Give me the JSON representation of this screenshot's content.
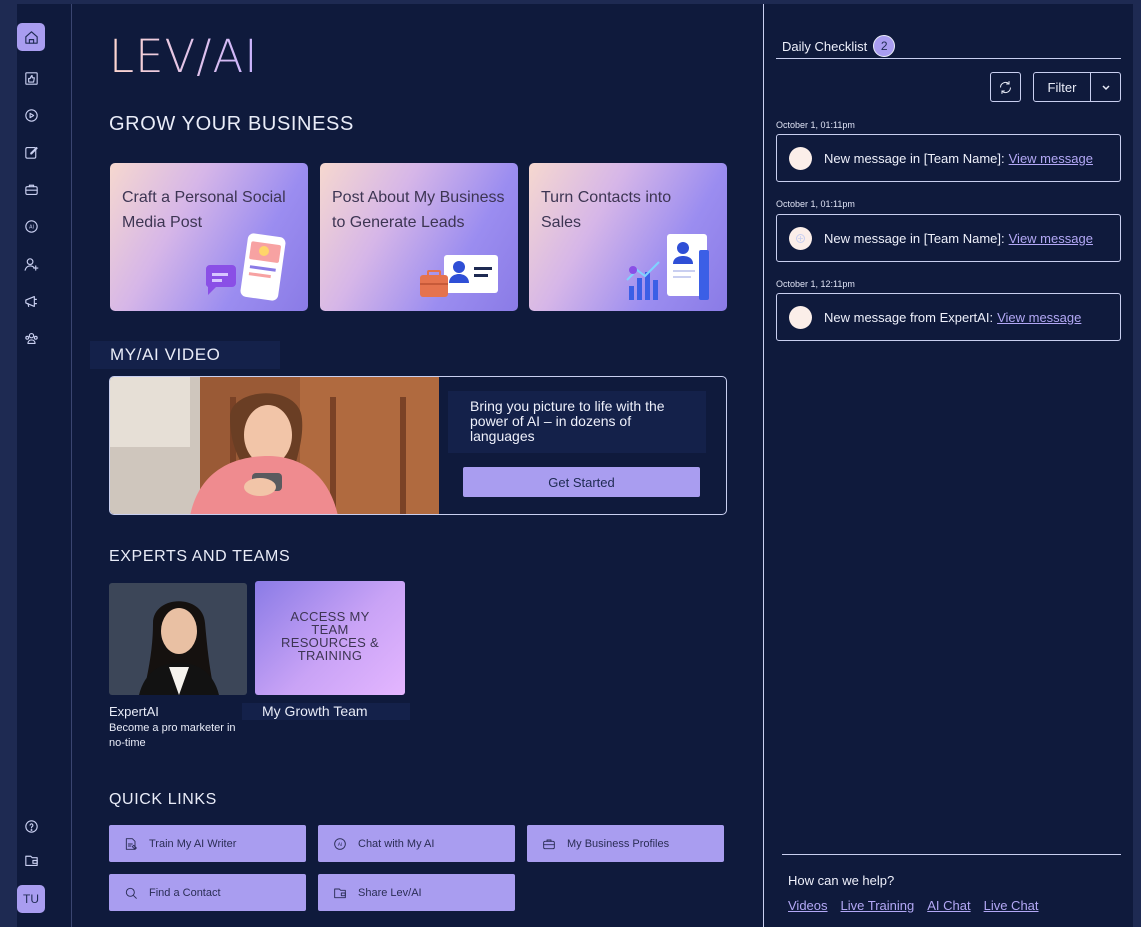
{
  "app": {
    "logo_text": "LEV/AI",
    "user_initials": "TU"
  },
  "sidebar": {
    "items": [
      {
        "icon": "home-icon",
        "active": true
      },
      {
        "icon": "thumbs-up-icon"
      },
      {
        "icon": "play-icon"
      },
      {
        "icon": "edit-icon"
      },
      {
        "icon": "briefcase-icon"
      },
      {
        "icon": "ai-icon"
      },
      {
        "icon": "add-user-icon"
      },
      {
        "icon": "megaphone-icon"
      },
      {
        "icon": "team-icon"
      }
    ],
    "bottom_items": [
      {
        "icon": "help-icon"
      },
      {
        "icon": "wallet-icon"
      }
    ]
  },
  "main": {
    "grow_title": "GROW YOUR BUSINESS",
    "cards": [
      {
        "label": "Craft a Personal Social Media Post"
      },
      {
        "label": "Post About My Business to Generate Leads"
      },
      {
        "label": "Turn Contacts into Sales"
      }
    ],
    "video": {
      "section_title": "MY/AI VIDEO",
      "description": "Bring you picture to life with the power of AI – in dozens of languages",
      "button_label": "Get Started"
    },
    "experts": {
      "section_title": "EXPERTS AND TEAMS",
      "expert_name": "ExpertAI",
      "expert_tagline": "Become a pro marketer in no-time",
      "team_card_text": "ACCESS MY TEAM RESOURCES & TRAINING",
      "team_name": "My Growth Team"
    },
    "quick_links": {
      "section_title": "QUICK LINKS",
      "items": [
        {
          "label": "Train My AI Writer",
          "icon": "writer-icon"
        },
        {
          "label": "Chat with My AI",
          "icon": "chat-ai-icon"
        },
        {
          "label": "My Business Profiles",
          "icon": "briefcase-icon"
        },
        {
          "label": "Find a Contact",
          "icon": "search-icon"
        },
        {
          "label": "Share Lev/AI",
          "icon": "share-icon"
        }
      ]
    }
  },
  "checklist": {
    "title": "Daily Checklist",
    "count": "2",
    "filter_label": "Filter",
    "messages": [
      {
        "date": "October 1, 01:11pm",
        "text": "New message in [Team Name]:",
        "link": "View message"
      },
      {
        "date": "October 1, 01:11pm",
        "text": "New message in [Team Name]:",
        "link": "View message"
      },
      {
        "date": "October 1, 12:11pm",
        "text": "New message from ExpertAI:",
        "link": "View message"
      }
    ],
    "help": {
      "title": "How can we help?",
      "links": [
        "Videos",
        "Live Training",
        "AI Chat",
        "Live Chat"
      ]
    }
  }
}
